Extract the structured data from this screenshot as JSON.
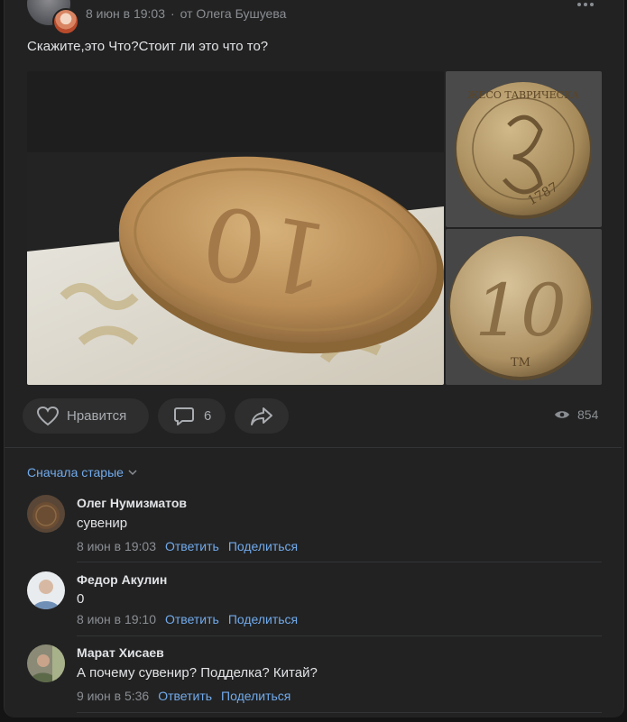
{
  "post": {
    "date": "8 июн в 19:03",
    "separator": "·",
    "from": "от Олега Бушуева",
    "text": "Скажите,это Что?Стоит ли это что то?",
    "coin_legend_top": "ЖЕСО ТАВРИЧЕСКА",
    "coin_year": "1787",
    "coin_denomination": "10",
    "coin_mark": "ТМ",
    "coin_mark_side": "ТМ"
  },
  "actions": {
    "like_label": "Нравится",
    "comments_count": "6",
    "views_count": "854"
  },
  "comments_sort": "Сначала старые",
  "comments": [
    {
      "author": "Олег Нумизматов",
      "text": "сувенир",
      "date": "8 июн в 19:03",
      "reply": "Ответить",
      "share": "Поделиться"
    },
    {
      "author": "Федор Акулин",
      "text": "0",
      "date": "8 июн в 19:10",
      "reply": "Ответить",
      "share": "Поделиться"
    },
    {
      "author": "Марат Хисаев",
      "text": "А почему сувенир? Подделка? Китай?",
      "date": "9 июн в 5:36",
      "reply": "Ответить",
      "share": "Поделиться"
    }
  ],
  "colors": {
    "background": "#141414",
    "card": "#222222",
    "link": "#71aaeb",
    "muted": "#8a8e93",
    "button": "#2e2e2e"
  },
  "icons": [
    "more-icon",
    "heart-icon",
    "comment-icon",
    "share-icon",
    "eye-icon",
    "chevron-down-icon"
  ]
}
